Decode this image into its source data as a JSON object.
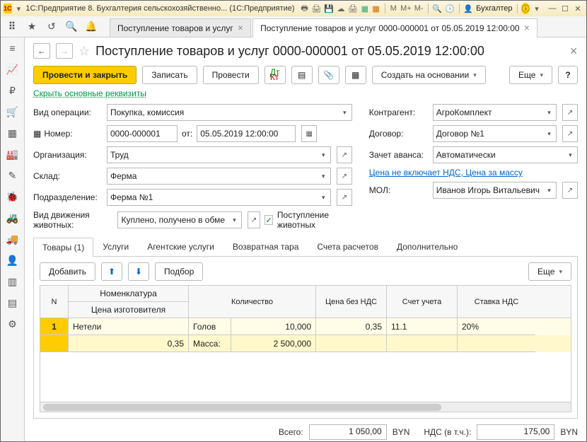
{
  "titlebar": {
    "logo": "1C",
    "title": "1С:Предприятие 8. Бухгалтерия сельскохозяйственно...  (1С:Предприятие)",
    "m_items": [
      "M",
      "M+",
      "M-"
    ],
    "user_label": "Бухгалтер",
    "info_label": "i"
  },
  "main_tabs": [
    {
      "label": "Поступление товаров и услуг",
      "active": false
    },
    {
      "label": "Поступление товаров и услуг 0000-000001 от 05.05.2019 12:00:00",
      "active": true
    }
  ],
  "doc": {
    "title": "Поступление товаров и услуг 0000-000001 от 05.05.2019 12:00:00",
    "primary_btn": "Провести и закрыть",
    "save_btn": "Записать",
    "post_btn": "Провести",
    "create_based": "Создать на основании",
    "more": "Еще",
    "help": "?",
    "hide_link": "Скрыть основные реквизиты"
  },
  "form": {
    "op_label": "Вид операции:",
    "op_value": "Покупка, комиссия",
    "num_label": "Номер:",
    "num_value": "0000-000001",
    "from_label": "от:",
    "date_value": "05.05.2019 12:00:00",
    "org_label": "Организация:",
    "org_value": "Труд",
    "store_label": "Склад:",
    "store_value": "Ферма",
    "dep_label": "Подразделение:",
    "dep_value": "Ферма №1",
    "mov_label": "Вид движения животных:",
    "mov_value": "Куплено, получено в обме",
    "chk_label": "Поступление животных",
    "pr_label": "Контрагент:",
    "pr_value": "АгроКомплект",
    "dog_label": "Договор:",
    "dog_value": "Договор №1",
    "avans_label": "Зачет аванса:",
    "avans_value": "Автоматически",
    "price_link": "Цена не включает НДС, Цена за массу",
    "mol_label": "МОЛ:",
    "mol_value": "Иванов Игорь Витальевич"
  },
  "tabs": [
    {
      "label": "Товары (1)",
      "active": true
    },
    {
      "label": "Услуги"
    },
    {
      "label": "Агентские услуги"
    },
    {
      "label": "Возвратная тара"
    },
    {
      "label": "Счета расчетов"
    },
    {
      "label": "Дополнительно"
    }
  ],
  "table_cmds": {
    "add": "Добавить",
    "pick": "Подбор",
    "more": "Еще"
  },
  "grid": {
    "headers": {
      "n": "N",
      "nom": "Номенклатура",
      "nom_sub": "Цена изготовителя",
      "qty": "Количество",
      "price": "Цена без НДС",
      "acc": "Счет учета",
      "vat": "Ставка НДС"
    },
    "rows": [
      {
        "n": "1",
        "nom": "Нетели",
        "nom_sub": "0,35",
        "qty_label": "Голов",
        "qty_val": "10,000",
        "mass_label": "Масса:",
        "mass_val": "2 500,000",
        "price": "0,35",
        "acc": "11.1",
        "vat": "20%"
      }
    ]
  },
  "totals": {
    "total_label": "Всего:",
    "total_value": "1 050,00",
    "cur1": "BYN",
    "vat_label": "НДС (в т.ч.):",
    "vat_value": "175,00",
    "cur2": "BYN"
  }
}
